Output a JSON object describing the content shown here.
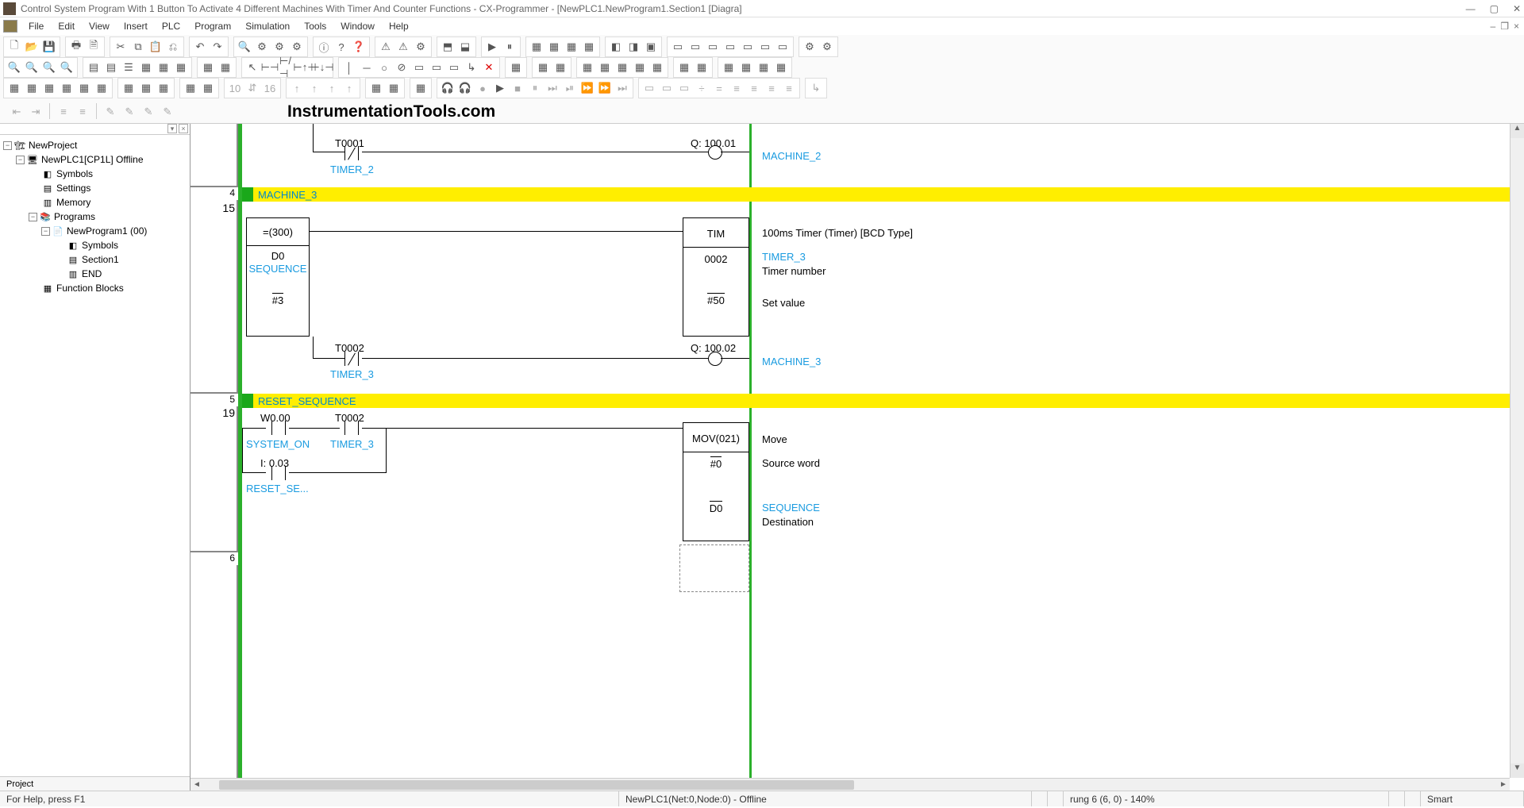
{
  "window": {
    "title": "Control System Program With 1 Button To Activate 4 Different Machines With Timer And Counter Functions - CX-Programmer - [NewPLC1.NewProgram1.Section1 [Diagra]"
  },
  "menubar": {
    "items": [
      "File",
      "Edit",
      "View",
      "Insert",
      "PLC",
      "Program",
      "Simulation",
      "Tools",
      "Window",
      "Help"
    ]
  },
  "watermark": "InstrumentationTools.com",
  "tree": {
    "root": "NewProject",
    "plc": "NewPLC1[CP1L] Offline",
    "symbols": "Symbols",
    "settings": "Settings",
    "memory": "Memory",
    "programs": "Programs",
    "program1": "NewProgram1 (00)",
    "p_symbols": "Symbols",
    "section1": "Section1",
    "end": "END",
    "fb": "Function Blocks",
    "tab": "Project"
  },
  "ladder": {
    "rung_top": {
      "t_addr": "T0001",
      "t_name": "TIMER_2",
      "q_addr": "Q: 100.01",
      "q_name": "MACHINE_2"
    },
    "rung4": {
      "num": "4",
      "step": "15",
      "section": "MACHINE_3",
      "cmp_op": "=(300)",
      "cmp_d": "D0",
      "cmp_name": "SEQUENCE",
      "cmp_val": "#3",
      "tim": "TIM",
      "tim_no": "0002",
      "tim_sv": "#50",
      "tim_desc": "100ms Timer (Timer) [BCD Type]",
      "tim_name": "TIMER_3",
      "tim_no_lbl": "Timer number",
      "tim_sv_lbl": "Set value",
      "t_addr": "T0002",
      "t_name": "TIMER_3",
      "q_addr": "Q: 100.02",
      "q_name": "MACHINE_3"
    },
    "rung5": {
      "num": "5",
      "step": "19",
      "section": "RESET_SEQUENCE",
      "w_addr": "W0.00",
      "w_name": "SYSTEM_ON",
      "t_addr": "T0002",
      "t_name": "TIMER_3",
      "i_addr": "I: 0.03",
      "i_name": "RESET_SE...",
      "mov": "MOV(021)",
      "mov_src": "#0",
      "mov_dst": "D0",
      "mov_desc": "Move",
      "mov_src_lbl": "Source word",
      "mov_dst_name": "SEQUENCE",
      "mov_dst_lbl": "Destination"
    },
    "rung6": {
      "num": "6"
    }
  },
  "statusbar": {
    "help": "For Help, press F1",
    "conn": "NewPLC1(Net:0,Node:0) - Offline",
    "rung": "rung 6 (6, 0)  - 140%",
    "smart": "Smart"
  }
}
